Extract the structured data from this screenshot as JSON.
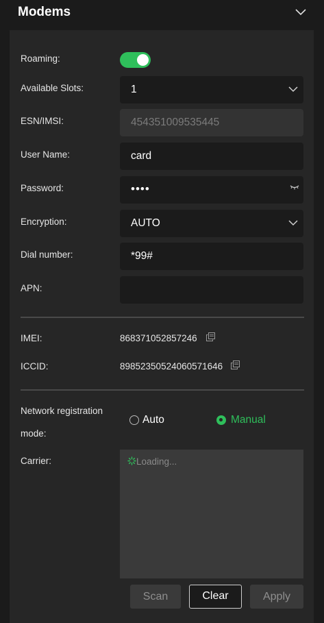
{
  "header": {
    "title": "Modems"
  },
  "fields": {
    "roaming_label": "Roaming:",
    "roaming_on": true,
    "slots_label": "Available Slots:",
    "slots_value": "1",
    "esn_label": "ESN/IMSI:",
    "esn_value": "454351009535445",
    "username_label": "User Name:",
    "username_value": "card",
    "password_label": "Password:",
    "password_value": "••••",
    "encryption_label": "Encryption:",
    "encryption_value": "AUTO",
    "dial_label": "Dial number:",
    "dial_value": "*99#",
    "apn_label": "APN:",
    "apn_value": ""
  },
  "info": {
    "imei_label": "IMEI:",
    "imei_value": "868371052857246",
    "iccid_label": "ICCID:",
    "iccid_value": "89852350524060571646"
  },
  "network": {
    "label_line1": "Network registration",
    "label_line2": "mode:",
    "auto_label": "Auto",
    "manual_label": "Manual",
    "selected": "Manual",
    "carrier_label": "Carrier:",
    "carrier_loading": "Loading..."
  },
  "buttons": {
    "scan": "Scan",
    "clear": "Clear",
    "apply": "Apply"
  },
  "colors": {
    "accent": "#2fbf5b",
    "panel": "#262626",
    "input_bg": "#1b1b1b"
  },
  "icons": [
    "chevron-down-icon",
    "eye-closed-icon",
    "copy-icon",
    "spinner-icon"
  ]
}
